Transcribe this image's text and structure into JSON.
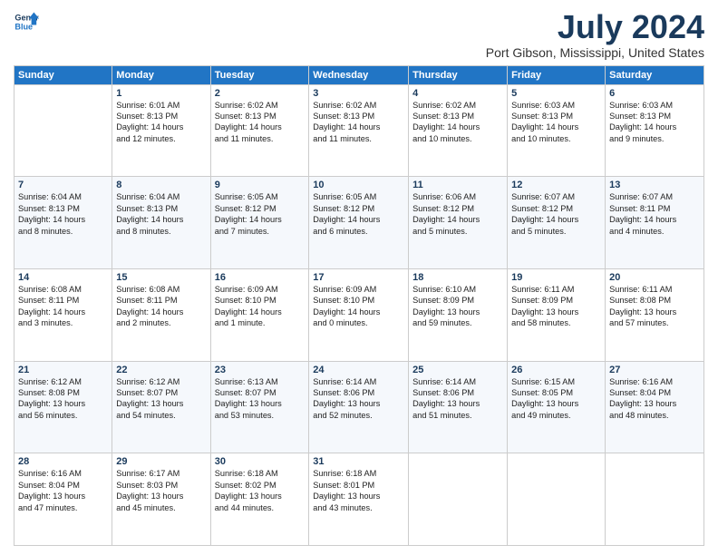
{
  "logo": {
    "line1": "General",
    "line2": "Blue"
  },
  "title": "July 2024",
  "subtitle": "Port Gibson, Mississippi, United States",
  "weekdays": [
    "Sunday",
    "Monday",
    "Tuesday",
    "Wednesday",
    "Thursday",
    "Friday",
    "Saturday"
  ],
  "weeks": [
    [
      {
        "day": "",
        "info": ""
      },
      {
        "day": "1",
        "info": "Sunrise: 6:01 AM\nSunset: 8:13 PM\nDaylight: 14 hours\nand 12 minutes."
      },
      {
        "day": "2",
        "info": "Sunrise: 6:02 AM\nSunset: 8:13 PM\nDaylight: 14 hours\nand 11 minutes."
      },
      {
        "day": "3",
        "info": "Sunrise: 6:02 AM\nSunset: 8:13 PM\nDaylight: 14 hours\nand 11 minutes."
      },
      {
        "day": "4",
        "info": "Sunrise: 6:02 AM\nSunset: 8:13 PM\nDaylight: 14 hours\nand 10 minutes."
      },
      {
        "day": "5",
        "info": "Sunrise: 6:03 AM\nSunset: 8:13 PM\nDaylight: 14 hours\nand 10 minutes."
      },
      {
        "day": "6",
        "info": "Sunrise: 6:03 AM\nSunset: 8:13 PM\nDaylight: 14 hours\nand 9 minutes."
      }
    ],
    [
      {
        "day": "7",
        "info": "Sunrise: 6:04 AM\nSunset: 8:13 PM\nDaylight: 14 hours\nand 8 minutes."
      },
      {
        "day": "8",
        "info": "Sunrise: 6:04 AM\nSunset: 8:13 PM\nDaylight: 14 hours\nand 8 minutes."
      },
      {
        "day": "9",
        "info": "Sunrise: 6:05 AM\nSunset: 8:12 PM\nDaylight: 14 hours\nand 7 minutes."
      },
      {
        "day": "10",
        "info": "Sunrise: 6:05 AM\nSunset: 8:12 PM\nDaylight: 14 hours\nand 6 minutes."
      },
      {
        "day": "11",
        "info": "Sunrise: 6:06 AM\nSunset: 8:12 PM\nDaylight: 14 hours\nand 5 minutes."
      },
      {
        "day": "12",
        "info": "Sunrise: 6:07 AM\nSunset: 8:12 PM\nDaylight: 14 hours\nand 5 minutes."
      },
      {
        "day": "13",
        "info": "Sunrise: 6:07 AM\nSunset: 8:11 PM\nDaylight: 14 hours\nand 4 minutes."
      }
    ],
    [
      {
        "day": "14",
        "info": "Sunrise: 6:08 AM\nSunset: 8:11 PM\nDaylight: 14 hours\nand 3 minutes."
      },
      {
        "day": "15",
        "info": "Sunrise: 6:08 AM\nSunset: 8:11 PM\nDaylight: 14 hours\nand 2 minutes."
      },
      {
        "day": "16",
        "info": "Sunrise: 6:09 AM\nSunset: 8:10 PM\nDaylight: 14 hours\nand 1 minute."
      },
      {
        "day": "17",
        "info": "Sunrise: 6:09 AM\nSunset: 8:10 PM\nDaylight: 14 hours\nand 0 minutes."
      },
      {
        "day": "18",
        "info": "Sunrise: 6:10 AM\nSunset: 8:09 PM\nDaylight: 13 hours\nand 59 minutes."
      },
      {
        "day": "19",
        "info": "Sunrise: 6:11 AM\nSunset: 8:09 PM\nDaylight: 13 hours\nand 58 minutes."
      },
      {
        "day": "20",
        "info": "Sunrise: 6:11 AM\nSunset: 8:08 PM\nDaylight: 13 hours\nand 57 minutes."
      }
    ],
    [
      {
        "day": "21",
        "info": "Sunrise: 6:12 AM\nSunset: 8:08 PM\nDaylight: 13 hours\nand 56 minutes."
      },
      {
        "day": "22",
        "info": "Sunrise: 6:12 AM\nSunset: 8:07 PM\nDaylight: 13 hours\nand 54 minutes."
      },
      {
        "day": "23",
        "info": "Sunrise: 6:13 AM\nSunset: 8:07 PM\nDaylight: 13 hours\nand 53 minutes."
      },
      {
        "day": "24",
        "info": "Sunrise: 6:14 AM\nSunset: 8:06 PM\nDaylight: 13 hours\nand 52 minutes."
      },
      {
        "day": "25",
        "info": "Sunrise: 6:14 AM\nSunset: 8:06 PM\nDaylight: 13 hours\nand 51 minutes."
      },
      {
        "day": "26",
        "info": "Sunrise: 6:15 AM\nSunset: 8:05 PM\nDaylight: 13 hours\nand 49 minutes."
      },
      {
        "day": "27",
        "info": "Sunrise: 6:16 AM\nSunset: 8:04 PM\nDaylight: 13 hours\nand 48 minutes."
      }
    ],
    [
      {
        "day": "28",
        "info": "Sunrise: 6:16 AM\nSunset: 8:04 PM\nDaylight: 13 hours\nand 47 minutes."
      },
      {
        "day": "29",
        "info": "Sunrise: 6:17 AM\nSunset: 8:03 PM\nDaylight: 13 hours\nand 45 minutes."
      },
      {
        "day": "30",
        "info": "Sunrise: 6:18 AM\nSunset: 8:02 PM\nDaylight: 13 hours\nand 44 minutes."
      },
      {
        "day": "31",
        "info": "Sunrise: 6:18 AM\nSunset: 8:01 PM\nDaylight: 13 hours\nand 43 minutes."
      },
      {
        "day": "",
        "info": ""
      },
      {
        "day": "",
        "info": ""
      },
      {
        "day": "",
        "info": ""
      }
    ]
  ]
}
